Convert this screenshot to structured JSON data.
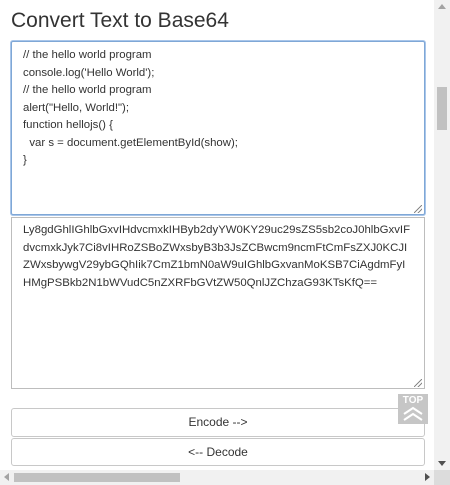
{
  "page": {
    "title": "Convert Text to Base64"
  },
  "input": {
    "value": "// the hello world program\nconsole.log('Hello World');\n// the hello world program\nalert(\"Hello, World!\");\nfunction hellojs() {\n  var s = document.getElementById(show);\n}"
  },
  "output": {
    "value": "Ly8gdGhlIGhlbGxvIHdvcmxkIHByb2dyYW0KY29uc29sZS5sb2coJ0hlbGxvIFdvcmxkJyk7Ci8vIHRoZSBoZWxsbyB3b3JsZCBwcm9ncmFtCmFsZXJ0KCJIZWxsbywgV29ybGQhIik7CmZ1bmN0aW9uIGhlbGxvanMoKSB7CiAgdmFyIHMgPSBkb2N1bWVudC5nZXRFbGVtZW50QnlJZChzaG93KTsKfQ=="
  },
  "buttons": {
    "encode_label": "Encode -->",
    "decode_label": "<-- Decode",
    "top_label": "TOP"
  },
  "colors": {
    "focus_border": "#7fa7d6",
    "top_button_bg": "#c6c6c6"
  }
}
